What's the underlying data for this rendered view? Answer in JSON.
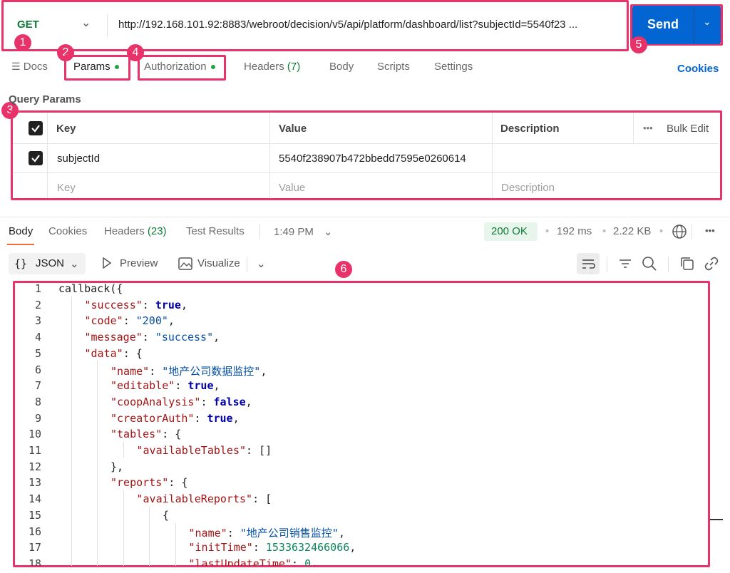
{
  "request": {
    "method": "GET",
    "url": "http://192.168.101.92:8883/webroot/decision/v5/api/platform/dashboard/list?subjectId=5540f23 ...",
    "send_label": "Send"
  },
  "callouts": [
    "1",
    "2",
    "3",
    "4",
    "5",
    "6"
  ],
  "request_tabs": [
    {
      "label": "Docs"
    },
    {
      "label": "Params"
    },
    {
      "label": "Authorization"
    },
    {
      "label": "Headers",
      "count": "(7)"
    },
    {
      "label": "Body"
    },
    {
      "label": "Scripts"
    },
    {
      "label": "Settings"
    }
  ],
  "cookies_link": "Cookies",
  "query_params": {
    "title": "Query Params",
    "headers": {
      "key": "Key",
      "value": "Value",
      "description": "Description",
      "bulk_edit": "Bulk Edit"
    },
    "rows": [
      {
        "key": "subjectId",
        "value": "5540f238907b472bbedd7595e0260614",
        "description": ""
      }
    ],
    "placeholders": {
      "key": "Key",
      "value": "Value",
      "description": "Description"
    }
  },
  "response": {
    "tabs": [
      {
        "label": "Body"
      },
      {
        "label": "Cookies"
      },
      {
        "label": "Headers",
        "count": "(23)"
      },
      {
        "label": "Test Results"
      }
    ],
    "time_label": "1:49 PM",
    "status": "200 OK",
    "duration": "192 ms",
    "size": "2.22 KB",
    "format": "JSON",
    "preview_label": "Preview",
    "visualize_label": "Visualize"
  },
  "colors": {
    "accent": "#e8336a",
    "send": "#0265d2",
    "status_ok": "#0b7a33"
  },
  "code_lines": [
    {
      "n": "1",
      "indent": 0,
      "parts": [
        {
          "t": "callback({",
          "c": ""
        }
      ]
    },
    {
      "n": "2",
      "indent": 1,
      "parts": [
        {
          "t": "\"success\"",
          "c": "k"
        },
        {
          "t": ": ",
          "c": ""
        },
        {
          "t": "true",
          "c": "b"
        },
        {
          "t": ",",
          "c": ""
        }
      ]
    },
    {
      "n": "3",
      "indent": 1,
      "parts": [
        {
          "t": "\"code\"",
          "c": "k"
        },
        {
          "t": ": ",
          "c": ""
        },
        {
          "t": "\"200\"",
          "c": "s"
        },
        {
          "t": ",",
          "c": ""
        }
      ]
    },
    {
      "n": "4",
      "indent": 1,
      "parts": [
        {
          "t": "\"message\"",
          "c": "k"
        },
        {
          "t": ": ",
          "c": ""
        },
        {
          "t": "\"success\"",
          "c": "s"
        },
        {
          "t": ",",
          "c": ""
        }
      ]
    },
    {
      "n": "5",
      "indent": 1,
      "parts": [
        {
          "t": "\"data\"",
          "c": "k"
        },
        {
          "t": ": {",
          "c": ""
        }
      ]
    },
    {
      "n": "6",
      "indent": 2,
      "parts": [
        {
          "t": "\"name\"",
          "c": "k"
        },
        {
          "t": ": ",
          "c": ""
        },
        {
          "t": "\"地产公司数据监控\"",
          "c": "s"
        },
        {
          "t": ",",
          "c": ""
        }
      ]
    },
    {
      "n": "7",
      "indent": 2,
      "parts": [
        {
          "t": "\"editable\"",
          "c": "k"
        },
        {
          "t": ": ",
          "c": ""
        },
        {
          "t": "true",
          "c": "b"
        },
        {
          "t": ",",
          "c": ""
        }
      ]
    },
    {
      "n": "8",
      "indent": 2,
      "parts": [
        {
          "t": "\"coopAnalysis\"",
          "c": "k"
        },
        {
          "t": ": ",
          "c": ""
        },
        {
          "t": "false",
          "c": "b"
        },
        {
          "t": ",",
          "c": ""
        }
      ]
    },
    {
      "n": "9",
      "indent": 2,
      "parts": [
        {
          "t": "\"creatorAuth\"",
          "c": "k"
        },
        {
          "t": ": ",
          "c": ""
        },
        {
          "t": "true",
          "c": "b"
        },
        {
          "t": ",",
          "c": ""
        }
      ]
    },
    {
      "n": "10",
      "indent": 2,
      "parts": [
        {
          "t": "\"tables\"",
          "c": "k"
        },
        {
          "t": ": {",
          "c": ""
        }
      ]
    },
    {
      "n": "11",
      "indent": 3,
      "parts": [
        {
          "t": "\"availableTables\"",
          "c": "k"
        },
        {
          "t": ": []",
          "c": ""
        }
      ]
    },
    {
      "n": "12",
      "indent": 2,
      "parts": [
        {
          "t": "},",
          "c": ""
        }
      ]
    },
    {
      "n": "13",
      "indent": 2,
      "parts": [
        {
          "t": "\"reports\"",
          "c": "k"
        },
        {
          "t": ": {",
          "c": ""
        }
      ]
    },
    {
      "n": "14",
      "indent": 3,
      "parts": [
        {
          "t": "\"availableReports\"",
          "c": "k"
        },
        {
          "t": ": [",
          "c": ""
        }
      ]
    },
    {
      "n": "15",
      "indent": 4,
      "parts": [
        {
          "t": "{",
          "c": ""
        }
      ]
    },
    {
      "n": "16",
      "indent": 5,
      "parts": [
        {
          "t": "\"name\"",
          "c": "k"
        },
        {
          "t": ": ",
          "c": ""
        },
        {
          "t": "\"地产公司销售监控\"",
          "c": "s"
        },
        {
          "t": ",",
          "c": ""
        }
      ]
    },
    {
      "n": "17",
      "indent": 5,
      "parts": [
        {
          "t": "\"initTime\"",
          "c": "k"
        },
        {
          "t": ": ",
          "c": ""
        },
        {
          "t": "1533632466066",
          "c": "n"
        },
        {
          "t": ",",
          "c": ""
        }
      ]
    },
    {
      "n": "18",
      "indent": 5,
      "parts": [
        {
          "t": "\"lastUpdateTime\"",
          "c": "k"
        },
        {
          "t": ": ",
          "c": ""
        },
        {
          "t": "0",
          "c": "n"
        },
        {
          "t": ",",
          "c": ""
        }
      ]
    }
  ]
}
